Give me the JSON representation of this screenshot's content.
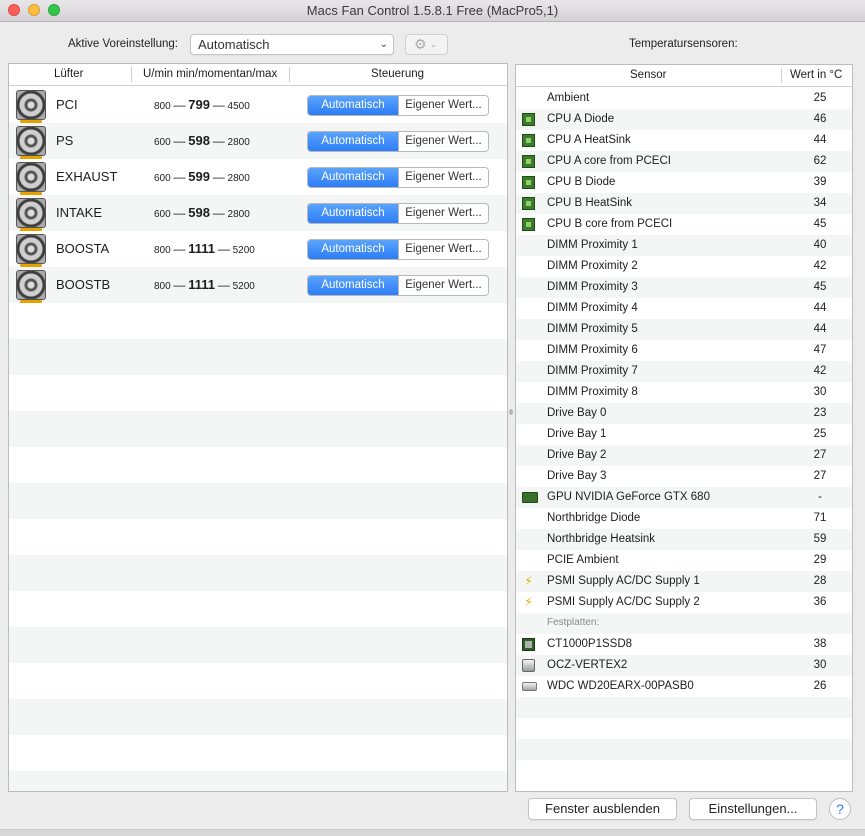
{
  "window": {
    "title": "Macs Fan Control 1.5.8.1 Free (MacPro5,1)"
  },
  "toolbar": {
    "preset_label": "Aktive Voreinstellung:",
    "preset_value": "Automatisch",
    "sensors_label": "Temperatursensoren:"
  },
  "fans_header": {
    "fan": "Lüfter",
    "rpm": "U/min min/momentan/max",
    "control": "Steuerung"
  },
  "fans": [
    {
      "name": "PCI",
      "min": "800",
      "current": "799",
      "max": "4500",
      "auto_label": "Automatisch",
      "custom_label": "Eigener Wert..."
    },
    {
      "name": "PS",
      "min": "600",
      "current": "598",
      "max": "2800",
      "auto_label": "Automatisch",
      "custom_label": "Eigener Wert..."
    },
    {
      "name": "EXHAUST",
      "min": "600",
      "current": "599",
      "max": "2800",
      "auto_label": "Automatisch",
      "custom_label": "Eigener Wert..."
    },
    {
      "name": "INTAKE",
      "min": "600",
      "current": "598",
      "max": "2800",
      "auto_label": "Automatisch",
      "custom_label": "Eigener Wert..."
    },
    {
      "name": "BOOSTA",
      "min": "800",
      "current": "1111",
      "max": "5200",
      "auto_label": "Automatisch",
      "custom_label": "Eigener Wert..."
    },
    {
      "name": "BOOSTB",
      "min": "800",
      "current": "1111",
      "max": "5200",
      "auto_label": "Automatisch",
      "custom_label": "Eigener Wert..."
    }
  ],
  "sensors_header": {
    "sensor": "Sensor",
    "value": "Wert in °C"
  },
  "sensors": [
    {
      "name": "Ambient",
      "value": "25",
      "icon": "none"
    },
    {
      "name": "CPU A Diode",
      "value": "46",
      "icon": "cpu-chip-icon"
    },
    {
      "name": "CPU A HeatSink",
      "value": "44",
      "icon": "cpu-chip-icon"
    },
    {
      "name": "CPU A core from PCECI",
      "value": "62",
      "icon": "cpu-chip-icon"
    },
    {
      "name": "CPU B Diode",
      "value": "39",
      "icon": "cpu-chip-icon"
    },
    {
      "name": "CPU B HeatSink",
      "value": "34",
      "icon": "cpu-chip-icon"
    },
    {
      "name": "CPU B core from PCECI",
      "value": "45",
      "icon": "cpu-chip-icon"
    },
    {
      "name": "DIMM Proximity 1",
      "value": "40",
      "icon": "none"
    },
    {
      "name": "DIMM Proximity 2",
      "value": "42",
      "icon": "none"
    },
    {
      "name": "DIMM Proximity 3",
      "value": "45",
      "icon": "none"
    },
    {
      "name": "DIMM Proximity 4",
      "value": "44",
      "icon": "none"
    },
    {
      "name": "DIMM Proximity 5",
      "value": "44",
      "icon": "none"
    },
    {
      "name": "DIMM Proximity 6",
      "value": "47",
      "icon": "none"
    },
    {
      "name": "DIMM Proximity 7",
      "value": "42",
      "icon": "none"
    },
    {
      "name": "DIMM Proximity 8",
      "value": "30",
      "icon": "none"
    },
    {
      "name": "Drive Bay 0",
      "value": "23",
      "icon": "none"
    },
    {
      "name": "Drive Bay 1",
      "value": "25",
      "icon": "none"
    },
    {
      "name": "Drive Bay 2",
      "value": "27",
      "icon": "none"
    },
    {
      "name": "Drive Bay 3",
      "value": "27",
      "icon": "none"
    },
    {
      "name": "GPU NVIDIA GeForce GTX 680",
      "value": "-",
      "icon": "gpu-card-icon"
    },
    {
      "name": "Northbridge Diode",
      "value": "71",
      "icon": "none"
    },
    {
      "name": "Northbridge Heatsink",
      "value": "59",
      "icon": "none"
    },
    {
      "name": "PCIE Ambient",
      "value": "29",
      "icon": "none"
    },
    {
      "name": "PSMI Supply AC/DC Supply 1",
      "value": "28",
      "icon": "lightning-bolt-icon"
    },
    {
      "name": "PSMI Supply AC/DC Supply 2",
      "value": "36",
      "icon": "lightning-bolt-icon"
    }
  ],
  "disks_section_label": "Festplatten:",
  "disks": [
    {
      "name": "CT1000P1SSD8",
      "value": "38",
      "icon": "ssd-icon"
    },
    {
      "name": "OCZ-VERTEX2",
      "value": "30",
      "icon": "hard-drive-icon"
    },
    {
      "name": "WDC WD20EARX-00PASB0",
      "value": "26",
      "icon": "hard-drive-icon"
    }
  ],
  "footer": {
    "hide_window": "Fenster ausblenden",
    "settings": "Einstellungen...",
    "help": "?"
  }
}
